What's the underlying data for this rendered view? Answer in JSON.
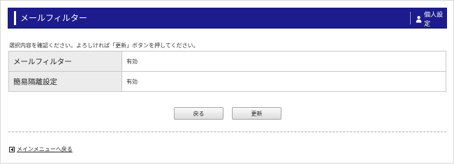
{
  "header": {
    "title": "メールフィルター",
    "personal_settings": "個人設定"
  },
  "instruction": "選択内容を確認ください。よろしければ「更新」ボタンを押してください。",
  "settings": [
    {
      "label": "メールフィルター",
      "value": "有効"
    },
    {
      "label": "簡易隔離設定",
      "value": "有効"
    }
  ],
  "buttons": {
    "back": "戻る",
    "update": "更新"
  },
  "footer": {
    "main_menu_link": "メインメニューへ戻る"
  },
  "colors": {
    "header_bg": "#1c1c8c",
    "label_bg": "#ececec"
  }
}
